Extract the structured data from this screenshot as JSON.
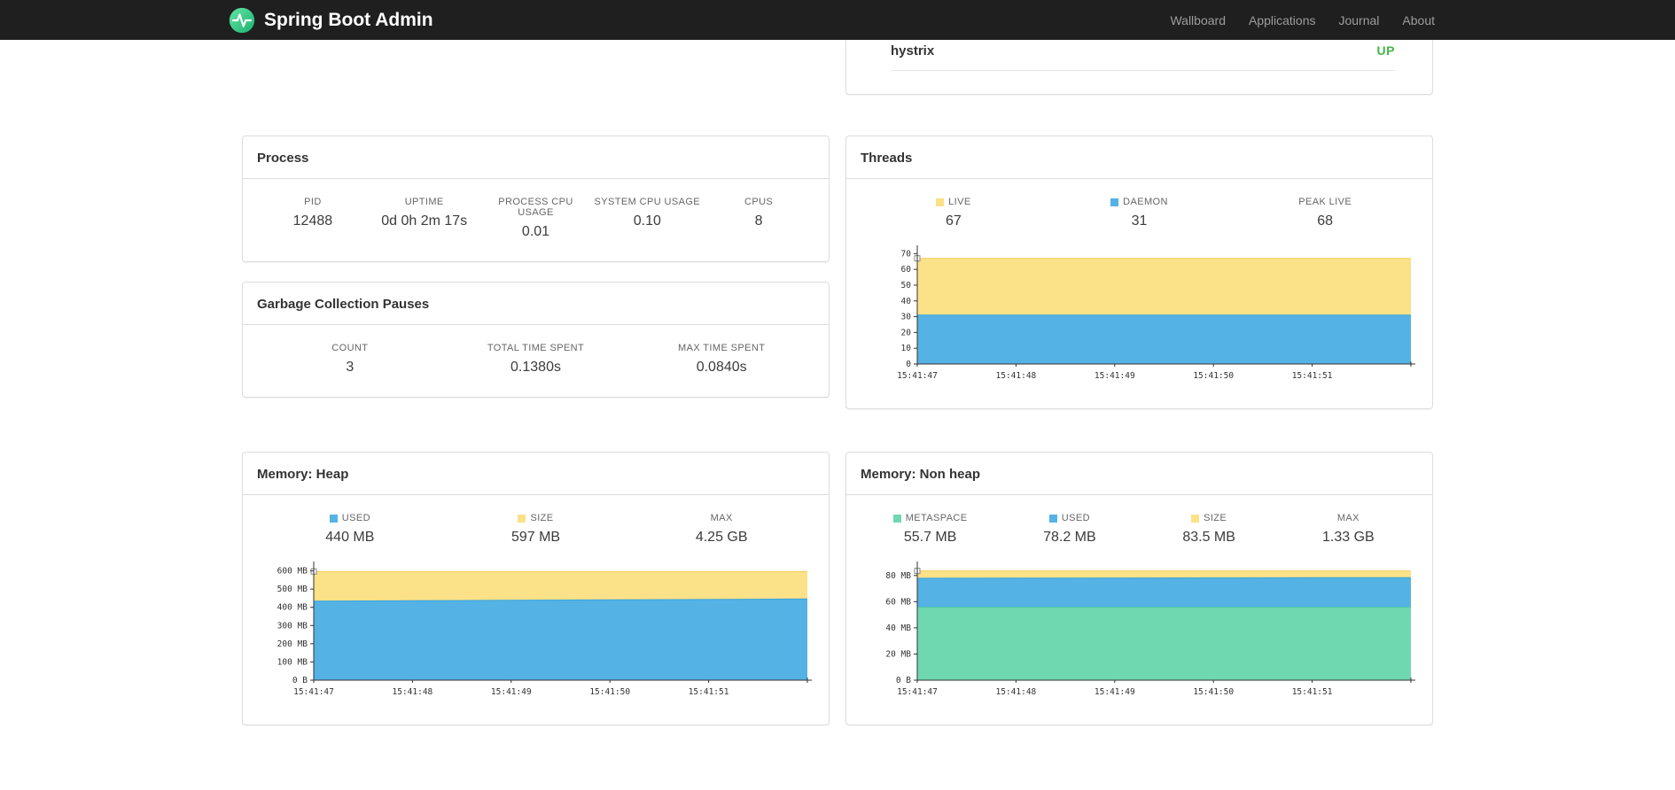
{
  "navbar": {
    "brand": "Spring Boot Admin",
    "links": [
      {
        "label": "Wallboard"
      },
      {
        "label": "Applications"
      },
      {
        "label": "Journal"
      },
      {
        "label": "About"
      }
    ]
  },
  "health": {
    "status_color": "#44b749",
    "rows": [
      {
        "name": "hystrix",
        "status": "UP"
      }
    ]
  },
  "process": {
    "title": "Process",
    "metrics": [
      {
        "label": "PID",
        "value": "12488"
      },
      {
        "label": "UPTIME",
        "value": "0d 0h 2m 17s"
      },
      {
        "label": "PROCESS CPU USAGE",
        "value": "0.01"
      },
      {
        "label": "SYSTEM CPU USAGE",
        "value": "0.10"
      },
      {
        "label": "CPUS",
        "value": "8"
      }
    ]
  },
  "gc": {
    "title": "Garbage Collection Pauses",
    "metrics": [
      {
        "label": "COUNT",
        "value": "3"
      },
      {
        "label": "TOTAL TIME SPENT",
        "value": "0.1380s"
      },
      {
        "label": "MAX TIME SPENT",
        "value": "0.0840s"
      }
    ]
  },
  "threads": {
    "title": "Threads",
    "metrics": [
      {
        "label": "LIVE",
        "value": "67",
        "color": "#fbe187"
      },
      {
        "label": "DAEMON",
        "value": "31",
        "color": "#54b2e5"
      },
      {
        "label": "PEAK LIVE",
        "value": "68"
      }
    ]
  },
  "heap": {
    "title": "Memory: Heap",
    "metrics": [
      {
        "label": "USED",
        "value": "440 MB",
        "color": "#54b2e5"
      },
      {
        "label": "SIZE",
        "value": "597 MB",
        "color": "#fbe187"
      },
      {
        "label": "MAX",
        "value": "4.25 GB"
      }
    ]
  },
  "nonheap": {
    "title": "Memory: Non heap",
    "metrics": [
      {
        "label": "METASPACE",
        "value": "55.7 MB",
        "color": "#70d8b1"
      },
      {
        "label": "USED",
        "value": "78.2 MB",
        "color": "#54b2e5"
      },
      {
        "label": "SIZE",
        "value": "83.5 MB",
        "color": "#fbe187"
      },
      {
        "label": "MAX",
        "value": "1.33 GB"
      }
    ]
  },
  "chart_data": [
    {
      "id": "threads",
      "type": "area",
      "title": "Threads",
      "xlabel": "",
      "ylabel": "",
      "grid": false,
      "legend_position": "above",
      "ylim": [
        0,
        73
      ],
      "yticks": [
        {
          "value": 0,
          "label": "0"
        },
        {
          "value": 10,
          "label": "10"
        },
        {
          "value": 20,
          "label": "20"
        },
        {
          "value": 30,
          "label": "30"
        },
        {
          "value": 40,
          "label": "40"
        },
        {
          "value": 50,
          "label": "50"
        },
        {
          "value": 60,
          "label": "60"
        },
        {
          "value": 70,
          "label": "70"
        }
      ],
      "xticks": [
        "15:41:47",
        "15:41:48",
        "15:41:49",
        "15:41:50",
        "15:41:51"
      ],
      "series": [
        {
          "name": "live",
          "color": "#fbe187",
          "stroke": "#f2cf5b",
          "values": [
            67,
            67,
            67,
            67,
            67,
            67
          ]
        },
        {
          "name": "daemon",
          "color": "#54b2e5",
          "stroke": "#3ba4dc",
          "values": [
            31,
            31,
            31,
            31,
            31,
            31
          ]
        }
      ]
    },
    {
      "id": "heap",
      "type": "area",
      "title": "Memory: Heap",
      "xlabel": "",
      "ylabel": "",
      "grid": false,
      "legend_position": "above",
      "ylim": [
        0,
        632
      ],
      "yticks": [
        {
          "value": 0,
          "label": "0 B"
        },
        {
          "value": 100,
          "label": "100 MB"
        },
        {
          "value": 200,
          "label": "200 MB"
        },
        {
          "value": 300,
          "label": "300 MB"
        },
        {
          "value": 400,
          "label": "400 MB"
        },
        {
          "value": 500,
          "label": "500 MB"
        },
        {
          "value": 600,
          "label": "600 MB"
        }
      ],
      "xticks": [
        "15:41:47",
        "15:41:48",
        "15:41:49",
        "15:41:50",
        "15:41:51"
      ],
      "series": [
        {
          "name": "size",
          "color": "#fbe187",
          "stroke": "#f2cf5b",
          "values": [
            597,
            597,
            597,
            597,
            597,
            597
          ]
        },
        {
          "name": "used",
          "color": "#54b2e5",
          "stroke": "#3ba4dc",
          "values": [
            434,
            436,
            439,
            441,
            443,
            446
          ]
        }
      ]
    },
    {
      "id": "nonheap",
      "type": "area",
      "title": "Memory: Non heap",
      "xlabel": "",
      "ylabel": "",
      "grid": false,
      "legend_position": "above",
      "ylim": [
        0,
        88
      ],
      "yticks": [
        {
          "value": 0,
          "label": "0 B"
        },
        {
          "value": 20,
          "label": "20 MB"
        },
        {
          "value": 40,
          "label": "40 MB"
        },
        {
          "value": 60,
          "label": "60 MB"
        },
        {
          "value": 80,
          "label": "80 MB"
        }
      ],
      "xticks": [
        "15:41:47",
        "15:41:48",
        "15:41:49",
        "15:41:50",
        "15:41:51"
      ],
      "series": [
        {
          "name": "size",
          "color": "#fbe187",
          "stroke": "#f2cf5b",
          "values": [
            83.5,
            83.5,
            83.5,
            83.5,
            83.5,
            83.5
          ]
        },
        {
          "name": "used",
          "color": "#54b2e5",
          "stroke": "#3ba4dc",
          "values": [
            77.9,
            78.0,
            78.1,
            78.2,
            78.3,
            78.4
          ]
        },
        {
          "name": "metaspace",
          "color": "#70d8b1",
          "stroke": "#4ecb9b",
          "values": [
            55.7,
            55.7,
            55.7,
            55.7,
            55.7,
            55.7
          ]
        }
      ]
    }
  ]
}
